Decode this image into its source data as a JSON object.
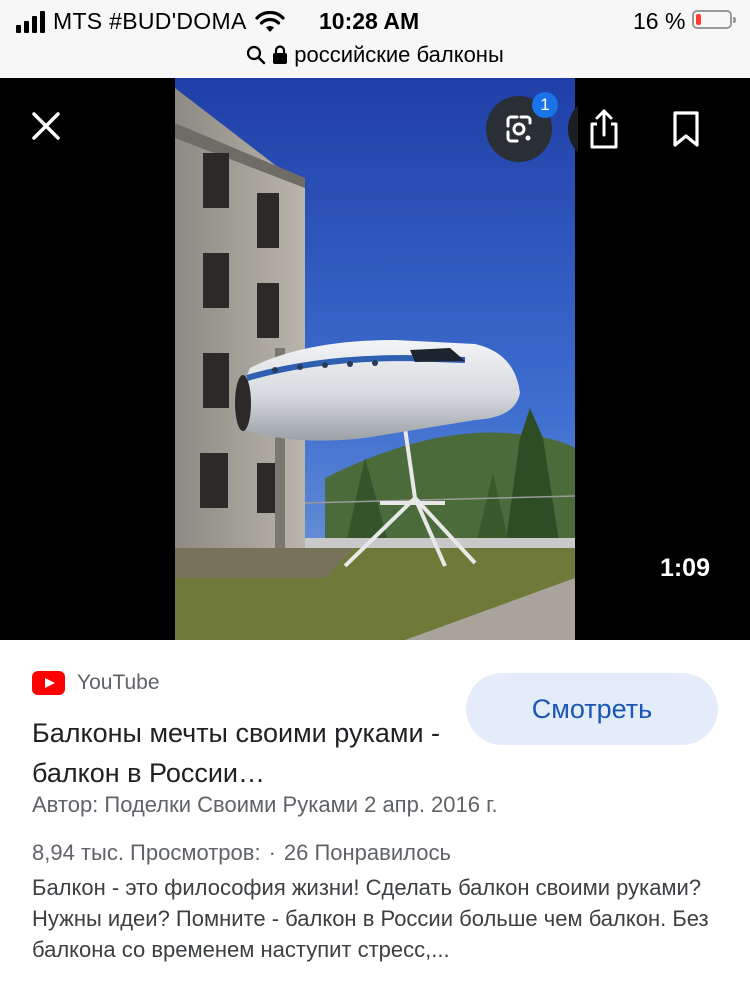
{
  "status_bar": {
    "carrier": "MTS #BUD'DOMA",
    "time": "10:28 AM",
    "battery_percent": "16 %",
    "battery_level": 0.16,
    "battery_color": "#ff3b30"
  },
  "url_bar": {
    "text": "российские балконы",
    "icons": [
      "search-icon",
      "lock-icon"
    ]
  },
  "viewer": {
    "close_icon": "close-icon",
    "lens_icon": "google-lens-icon",
    "lens_badge": "1",
    "share_icon": "share-icon",
    "bookmark_icon": "bookmark-icon",
    "duration": "1:09"
  },
  "result": {
    "source": "YouTube",
    "watch_label": "Смотреть",
    "title": "Балконы мечты своими руками - балкон в России…",
    "author": "Автор: Поделки Своими Руками 2 апр. 2016 г.",
    "views": "8,94 тыс. Просмотров:",
    "separator": "·",
    "likes": "26 Понравилось",
    "description": "Балкон - это философия жизни! Сделать балкон своими руками? Нужны идеи? Помните - балкон в России больше чем балкон. Без балкона со временем наступит стресс,..."
  },
  "colors": {
    "accent": "#1a73e8",
    "watch_button_bg": "#e3ecf8",
    "watch_button_text": "#1a57b6",
    "youtube_red": "#ff0000"
  }
}
